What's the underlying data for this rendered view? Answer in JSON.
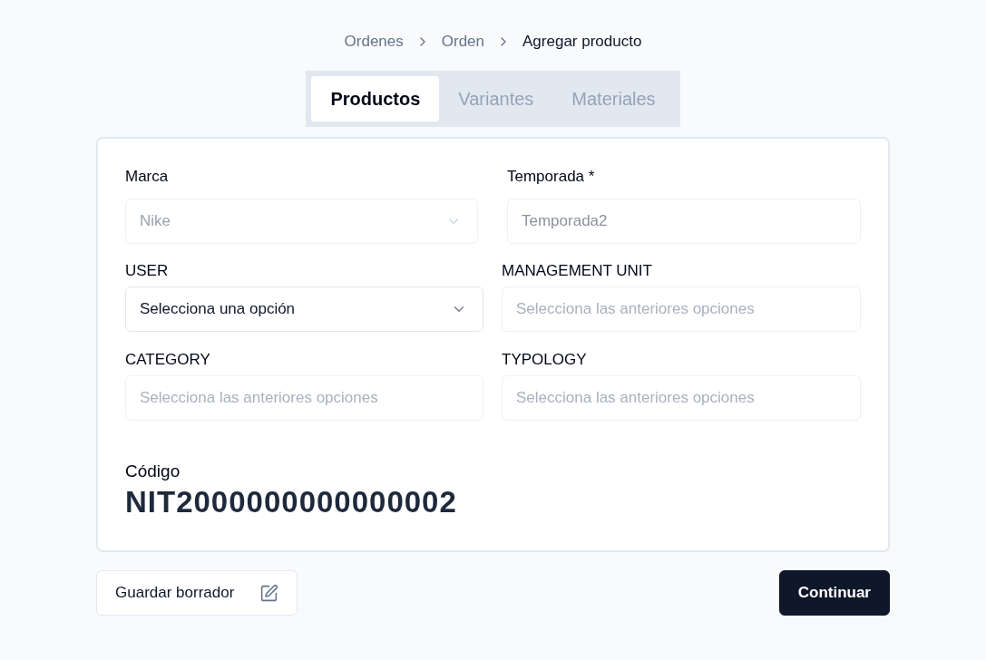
{
  "breadcrumb": [
    {
      "label": "Ordenes",
      "current": false
    },
    {
      "label": "Orden",
      "current": false
    },
    {
      "label": "Agregar producto",
      "current": true
    }
  ],
  "tabs": [
    {
      "label": "Productos",
      "selected": true
    },
    {
      "label": "Variantes",
      "selected": false
    },
    {
      "label": "Materiales",
      "selected": false
    }
  ],
  "form": {
    "main_fields": [
      {
        "label": "Marca",
        "kind": "select",
        "value": "Nike",
        "disabled": true
      },
      {
        "label": "Temporada *",
        "kind": "text",
        "value": "Temporada2",
        "disabled": true
      }
    ],
    "attribute_fields": [
      {
        "label": "USER",
        "kind": "select",
        "value": "Selecciona una opción",
        "disabled": false
      },
      {
        "label": "MANAGEMENT UNIT",
        "kind": "text",
        "placeholder": "Selecciona las anteriores opciones",
        "disabled": true
      },
      {
        "label": "CATEGORY",
        "kind": "text",
        "placeholder": "Selecciona las anteriores opciones",
        "disabled": true
      },
      {
        "label": "TYPOLOGY",
        "kind": "text",
        "placeholder": "Selecciona las anteriores opciones",
        "disabled": true
      }
    ],
    "code": {
      "label": "Código",
      "value": "NIT2000000000000002"
    }
  },
  "actions": [
    {
      "label": "Guardar borrador",
      "kind": "secondary"
    },
    {
      "label": "Continuar",
      "kind": "primary"
    }
  ]
}
